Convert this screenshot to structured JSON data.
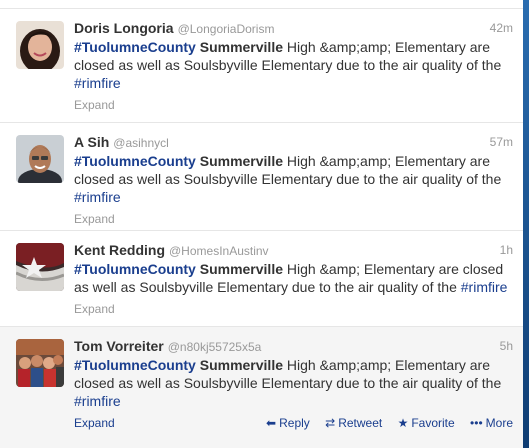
{
  "tweets": [
    {
      "fullname": "Doris Longoria",
      "username": "@LongoriaDorism",
      "time": "42m",
      "hashtag1": "#TuolumneCounty",
      "strong": "Summerville",
      "text_mid": " High &amp;amp; Elementary are closed as well as Soulsbyville Elementary due to the air quality of the ",
      "hashtag2": "#rimfire",
      "expand": "Expand"
    },
    {
      "fullname": "A Sih",
      "username": "@asihnycl",
      "time": "57m",
      "hashtag1": "#TuolumneCounty",
      "strong": "Summerville",
      "text_mid": " High &amp;amp; Elementary are closed as well as Soulsbyville Elementary due to the air quality of the ",
      "hashtag2": "#rimfire",
      "expand": "Expand"
    },
    {
      "fullname": "Kent Redding",
      "username": "@HomesInAustinv",
      "time": "1h",
      "hashtag1": "#TuolumneCounty",
      "strong": "Summerville",
      "text_mid": " High &amp; Elementary are closed as well as Soulsbyville Elementary due to the air quality of the ",
      "hashtag2": "#rimfire",
      "expand": "Expand"
    },
    {
      "fullname": "Tom Vorreiter",
      "username": "@n80kj55725x5a",
      "time": "5h",
      "hashtag1": "#TuolumneCounty",
      "strong": "Summerville",
      "text_mid": " High &amp;amp; Elementary are closed as well as Soulsbyville Elementary due to the air quality of the ",
      "hashtag2": "#rimfire",
      "expand": "Expand"
    }
  ],
  "actions": {
    "reply": "Reply",
    "retweet": "Retweet",
    "favorite": "Favorite",
    "more": "More"
  },
  "icons": {
    "reply": "reply-arrow-icon",
    "retweet": "retweet-icon",
    "favorite": "star-icon",
    "more": "ellipsis-icon"
  },
  "colors": {
    "link": "#1a3e8e",
    "muted": "#999999",
    "text": "#333333",
    "hover_bg": "#f5f5f5"
  }
}
